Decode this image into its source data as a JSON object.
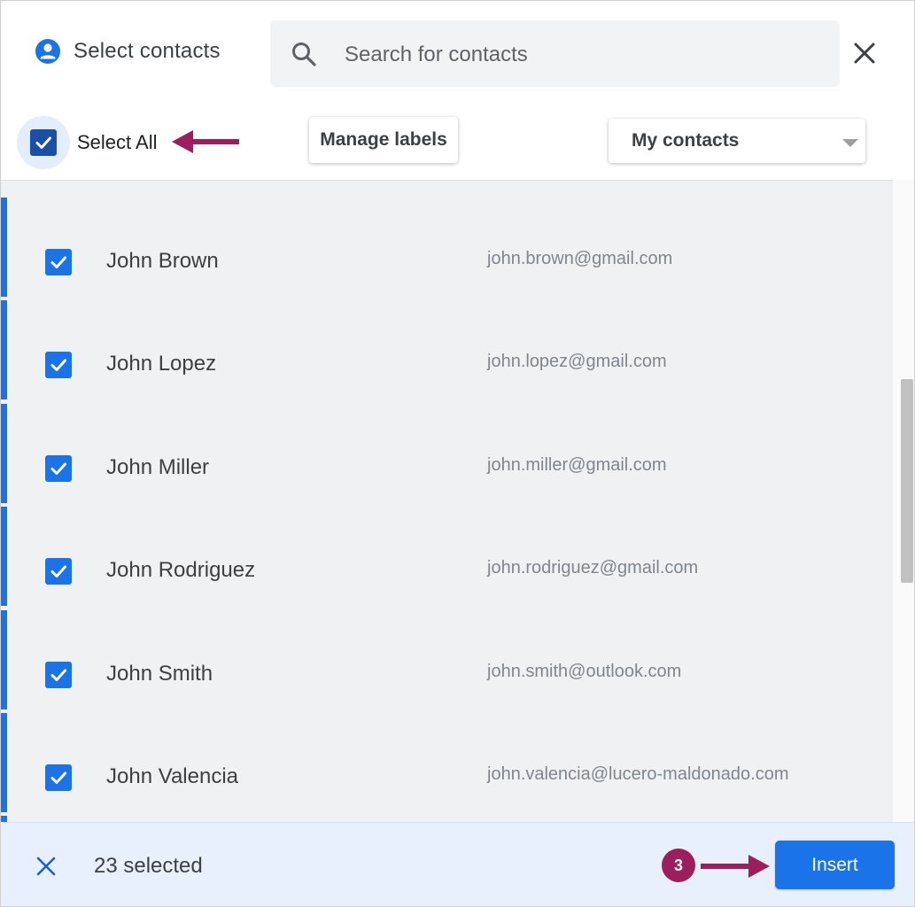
{
  "header": {
    "title": "Select contacts",
    "search_placeholder": "Search for contacts",
    "title_icon": "account-circle-icon",
    "close_icon": "close-icon"
  },
  "toolbar": {
    "select_all_label": "Select All",
    "select_all_checked": true,
    "manage_labels": "Manage labels",
    "filter_selected": "My contacts"
  },
  "contacts": [
    {
      "name": "John Brown",
      "email": "john.brown@gmail.com",
      "checked": true
    },
    {
      "name": "John Lopez",
      "email": "john.lopez@gmail.com",
      "checked": true
    },
    {
      "name": "John Miller",
      "email": "john.miller@gmail.com",
      "checked": true
    },
    {
      "name": "John Rodriguez",
      "email": "john.rodriguez@gmail.com",
      "checked": true
    },
    {
      "name": "John Smith",
      "email": "john.smith@outlook.com",
      "checked": true
    },
    {
      "name": "John Valencia",
      "email": "john.valencia@lucero-maldonado.com",
      "checked": true
    }
  ],
  "footer": {
    "selected_count": "23 selected",
    "step_badge": "3",
    "insert_label": "Insert"
  },
  "colors": {
    "accent": "#1a73e8",
    "annotation": "#9c1f5d",
    "footer_bg": "#e8f0fd"
  }
}
